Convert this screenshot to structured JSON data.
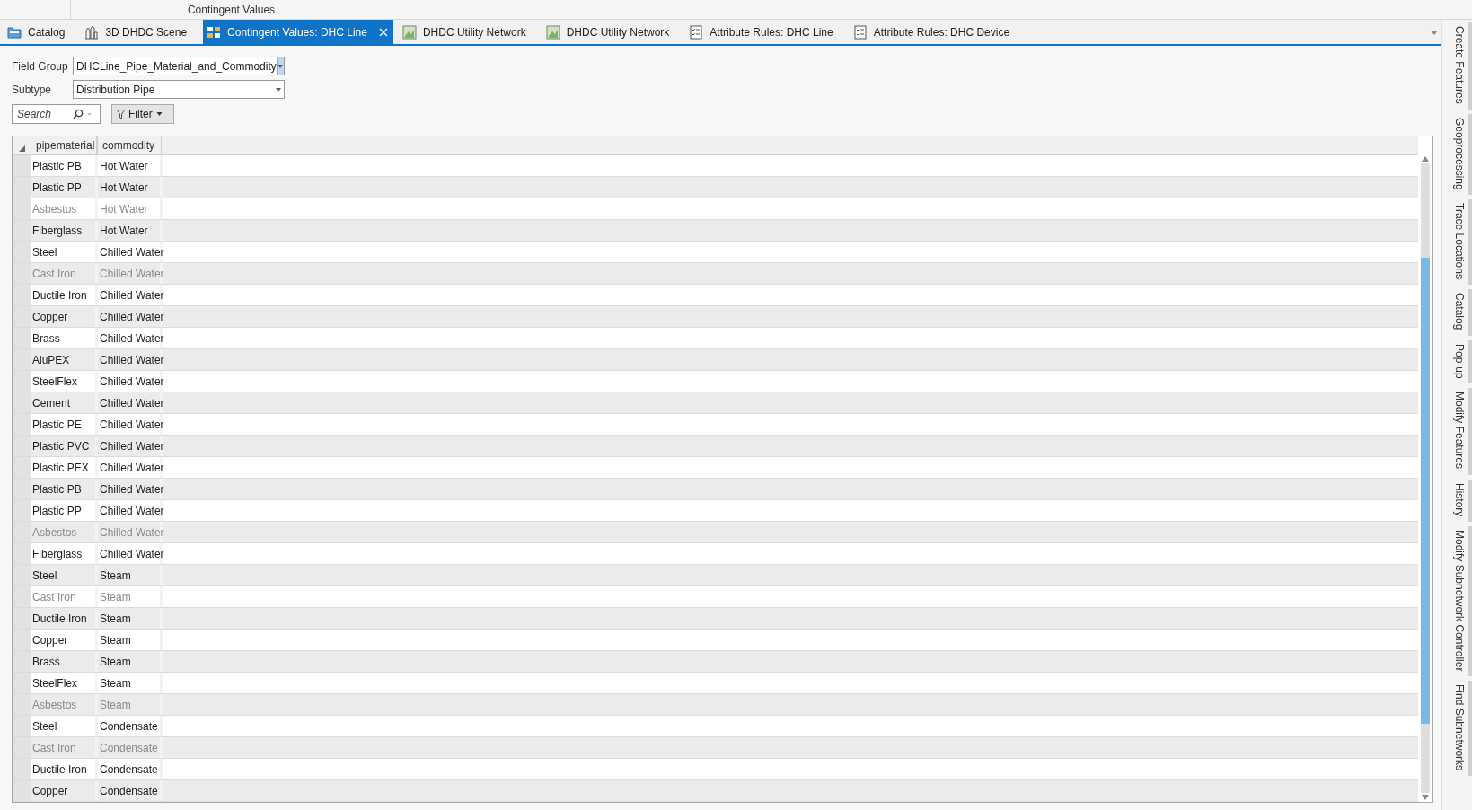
{
  "header": {
    "title": "Contingent Values"
  },
  "tabs": [
    {
      "label": "Catalog",
      "kind": "catalog",
      "selected": false
    },
    {
      "label": "3D DHDC Scene",
      "kind": "scene",
      "selected": false
    },
    {
      "label": "Contingent Values: DHC Line",
      "kind": "table",
      "selected": true
    },
    {
      "label": "DHDC Utility Network",
      "kind": "map",
      "selected": false
    },
    {
      "label": "DHDC Utility Network",
      "kind": "map",
      "selected": false
    },
    {
      "label": "Attribute Rules: DHC Line",
      "kind": "rules",
      "selected": false
    },
    {
      "label": "Attribute Rules: DHC Device",
      "kind": "rules",
      "selected": false
    }
  ],
  "dock_tabs": [
    "Create Features",
    "Geoprocessing",
    "Trace Locations",
    "Catalog",
    "Pop-up",
    "Modify Features",
    "History",
    "Modify Subnetwork Controller",
    "Find Subnetworks"
  ],
  "field_group": {
    "label": "Field Group",
    "value": "DHCLine_Pipe_Material_and_Commodity",
    "focused": true
  },
  "subtype": {
    "label": "Subtype",
    "value": "Distribution Pipe",
    "focused": false
  },
  "search": {
    "placeholder": "Search"
  },
  "filter": {
    "label": "Filter"
  },
  "table": {
    "columns": [
      "pipematerial",
      "commodity"
    ],
    "rows": [
      {
        "cells": [
          "Plastic PB",
          "Hot Water"
        ],
        "retired": false
      },
      {
        "cells": [
          "Plastic PP",
          "Hot Water"
        ],
        "retired": false
      },
      {
        "cells": [
          "Asbestos",
          "Hot Water"
        ],
        "retired": true
      },
      {
        "cells": [
          "Fiberglass",
          "Hot Water"
        ],
        "retired": false
      },
      {
        "cells": [
          "Steel",
          "Chilled Water"
        ],
        "retired": false
      },
      {
        "cells": [
          "Cast Iron",
          "Chilled Water"
        ],
        "retired": true
      },
      {
        "cells": [
          "Ductile Iron",
          "Chilled Water"
        ],
        "retired": false
      },
      {
        "cells": [
          "Copper",
          "Chilled Water"
        ],
        "retired": false
      },
      {
        "cells": [
          "Brass",
          "Chilled Water"
        ],
        "retired": false
      },
      {
        "cells": [
          "AluPEX",
          "Chilled Water"
        ],
        "retired": false
      },
      {
        "cells": [
          "SteelFlex",
          "Chilled Water"
        ],
        "retired": false
      },
      {
        "cells": [
          "Cement",
          "Chilled Water"
        ],
        "retired": false
      },
      {
        "cells": [
          "Plastic PE",
          "Chilled Water"
        ],
        "retired": false
      },
      {
        "cells": [
          "Plastic PVC",
          "Chilled Water"
        ],
        "retired": false
      },
      {
        "cells": [
          "Plastic PEX",
          "Chilled Water"
        ],
        "retired": false
      },
      {
        "cells": [
          "Plastic PB",
          "Chilled Water"
        ],
        "retired": false
      },
      {
        "cells": [
          "Plastic PP",
          "Chilled Water"
        ],
        "retired": false
      },
      {
        "cells": [
          "Asbestos",
          "Chilled Water"
        ],
        "retired": true
      },
      {
        "cells": [
          "Fiberglass",
          "Chilled Water"
        ],
        "retired": false
      },
      {
        "cells": [
          "Steel",
          "Steam"
        ],
        "retired": false
      },
      {
        "cells": [
          "Cast Iron",
          "Steam"
        ],
        "retired": true
      },
      {
        "cells": [
          "Ductile Iron",
          "Steam"
        ],
        "retired": false
      },
      {
        "cells": [
          "Copper",
          "Steam"
        ],
        "retired": false
      },
      {
        "cells": [
          "Brass",
          "Steam"
        ],
        "retired": false
      },
      {
        "cells": [
          "SteelFlex",
          "Steam"
        ],
        "retired": false
      },
      {
        "cells": [
          "Asbestos",
          "Steam"
        ],
        "retired": true
      },
      {
        "cells": [
          "Steel",
          "Condensate"
        ],
        "retired": false
      },
      {
        "cells": [
          "Cast Iron",
          "Condensate"
        ],
        "retired": true
      },
      {
        "cells": [
          "Ductile Iron",
          "Condensate"
        ],
        "retired": false
      },
      {
        "cells": [
          "Copper",
          "Condensate"
        ],
        "retired": false
      }
    ]
  }
}
